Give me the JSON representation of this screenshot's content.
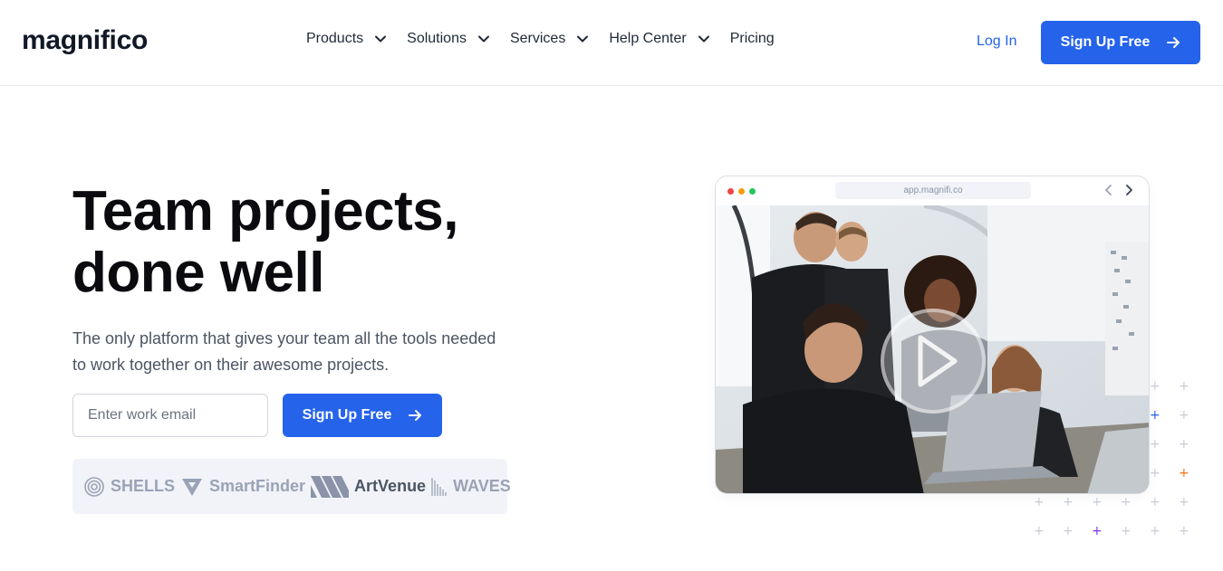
{
  "header": {
    "logo": "magnifico",
    "nav": [
      {
        "label": "Products",
        "has_dropdown": true
      },
      {
        "label": "Solutions",
        "has_dropdown": true
      },
      {
        "label": "Services",
        "has_dropdown": true
      },
      {
        "label": "Help Center",
        "has_dropdown": true
      },
      {
        "label": "Pricing",
        "has_dropdown": false
      }
    ],
    "login_label": "Log In",
    "signup_label": "Sign Up Free"
  },
  "hero": {
    "title_line1": "Team projects,",
    "title_line2": "done well",
    "subtitle": "The only platform that gives your team all the tools needed to work together on their awesome projects.",
    "email_placeholder": "Enter work email",
    "signup_label": "Sign Up Free"
  },
  "logos": [
    {
      "name": "SHELLS",
      "icon": "shell-icon"
    },
    {
      "name": "SmartFinder",
      "icon": "smartfinder-icon"
    },
    {
      "name": "ArtVenue",
      "icon": "artvenue-icon"
    },
    {
      "name": "WAVES",
      "icon": "waves-icon"
    }
  ],
  "browser": {
    "url": "app.magnifi.co",
    "traffic_lights": [
      "#ef4444",
      "#f59e0b",
      "#22c55e"
    ],
    "media": "team-photo-with-play-button"
  },
  "colors": {
    "accent": "#2563eb",
    "text": "#1f2937",
    "logos_bg": "#f1f3f8"
  }
}
